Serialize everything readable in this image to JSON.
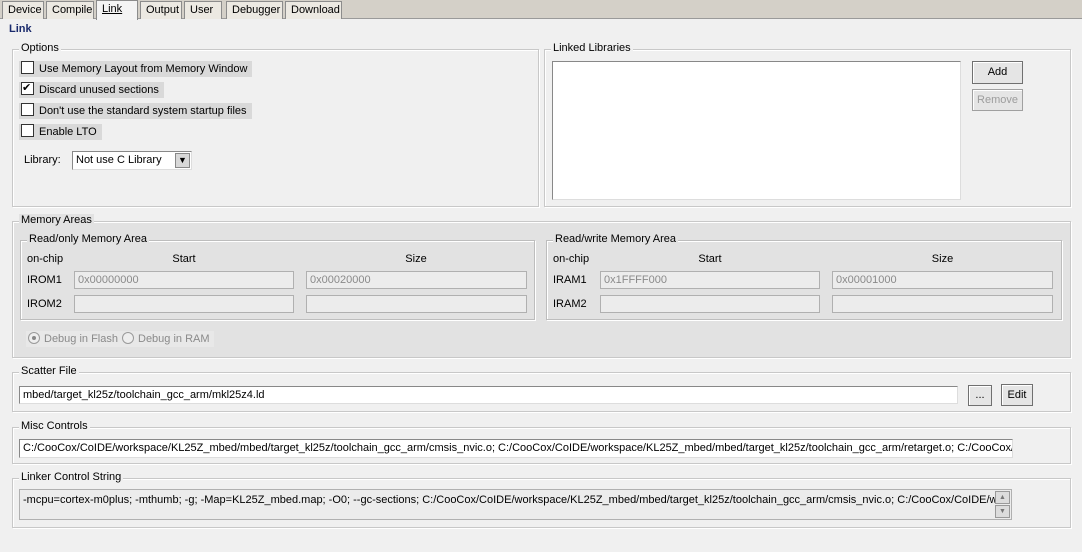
{
  "tabs": [
    "Device",
    "Compile",
    "Link",
    "Output",
    "User",
    "Debugger",
    "Download"
  ],
  "page_title": "Link",
  "options": {
    "legend": "Options",
    "checkboxes": [
      {
        "label": "Use Memory Layout from Memory Window",
        "checked": false
      },
      {
        "label": "Discard unused sections",
        "checked": true
      },
      {
        "label": "Don't use the standard system startup files",
        "checked": false
      },
      {
        "label": "Enable LTO",
        "checked": false
      }
    ],
    "library_label": "Library:",
    "library_value": "Not use C Library"
  },
  "linked_libraries": {
    "legend": "Linked Libraries",
    "add_label": "Add",
    "remove_label": "Remove"
  },
  "memory_areas": {
    "legend": "Memory Areas",
    "readonly": {
      "legend": "Read/only Memory Area",
      "onchip": "on-chip",
      "start_header": "Start",
      "size_header": "Size",
      "rows": [
        {
          "name": "IROM1",
          "start": "0x00000000",
          "size": "0x00020000"
        },
        {
          "name": "IROM2",
          "start": "",
          "size": ""
        }
      ]
    },
    "readwrite": {
      "legend": "Read/write Memory Area",
      "onchip": "on-chip",
      "start_header": "Start",
      "size_header": "Size",
      "rows": [
        {
          "name": "IRAM1",
          "start": "0x1FFFF000",
          "size": "0x00001000"
        },
        {
          "name": "IRAM2",
          "start": "",
          "size": ""
        }
      ]
    },
    "debug_flash": "Debug in Flash",
    "debug_ram": "Debug in RAM"
  },
  "scatter": {
    "legend": "Scatter File",
    "value": "mbed/target_kl25z/toolchain_gcc_arm/mkl25z4.ld",
    "browse_label": "...",
    "edit_label": "Edit"
  },
  "misc": {
    "legend": "Misc Controls",
    "value": "C:/CooCox/CoIDE/workspace/KL25Z_mbed/mbed/target_kl25z/toolchain_gcc_arm/cmsis_nvic.o; C:/CooCox/CoIDE/workspace/KL25Z_mbed/mbed/target_kl25z/toolchain_gcc_arm/retarget.o; C:/CooCox/C"
  },
  "linker": {
    "legend": "Linker Control String",
    "value": "-mcpu=cortex-m0plus; -mthumb; -g; -Map=KL25Z_mbed.map; -O0; --gc-sections; C:/CooCox/CoIDE/workspace/KL25Z_mbed/mbed/target_kl25z/toolchain_gcc_arm/cmsis_nvic.o; C:/CooCox/CoIDE/wo"
  }
}
